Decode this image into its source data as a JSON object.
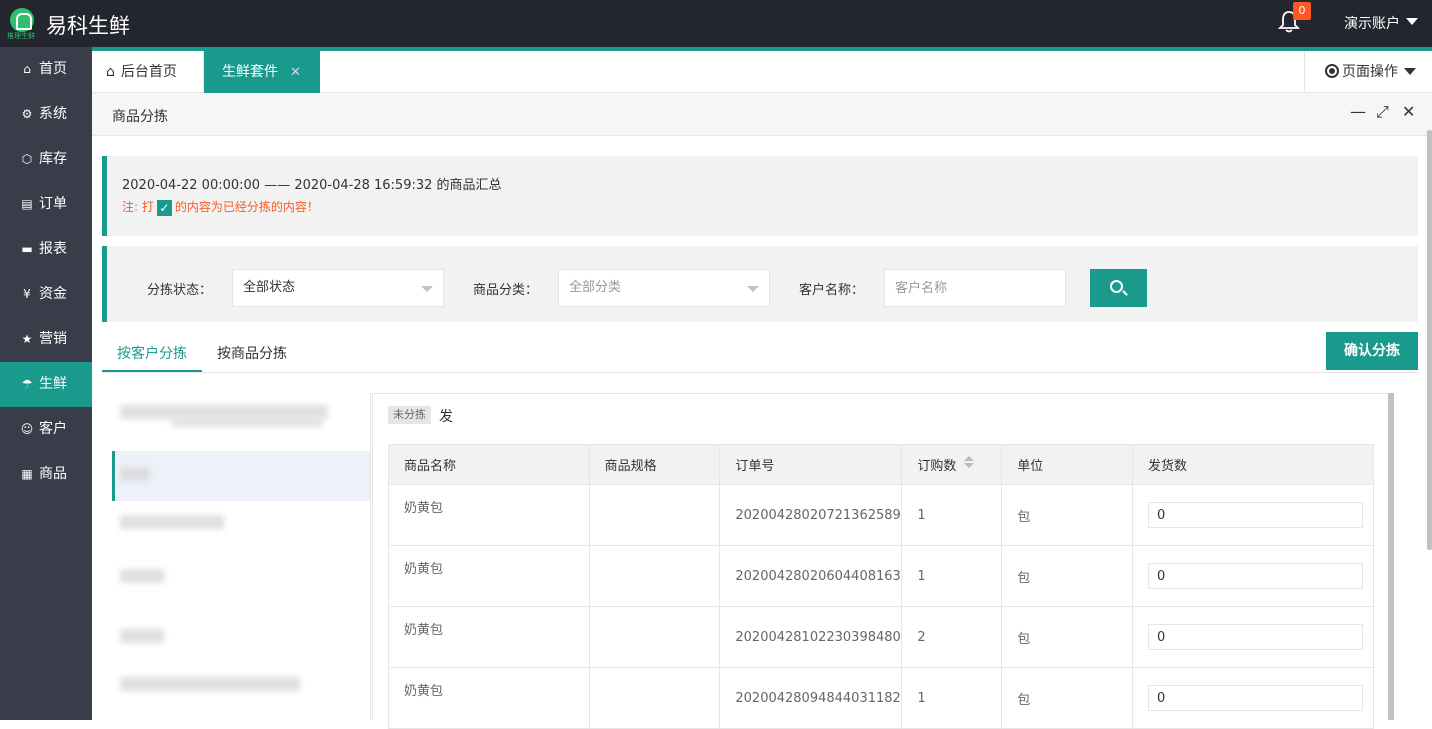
{
  "header": {
    "app_title": "易科生鲜",
    "logo_sub": "推理生鲜",
    "notification_count": "0",
    "account_label": "演示账户"
  },
  "sidebar": {
    "items": [
      {
        "label": "首页",
        "icon": "home-icon"
      },
      {
        "label": "系统",
        "icon": "gear-icon"
      },
      {
        "label": "库存",
        "icon": "box-icon"
      },
      {
        "label": "订单",
        "icon": "document-icon"
      },
      {
        "label": "报表",
        "icon": "monitor-icon"
      },
      {
        "label": "资金",
        "icon": "yen-icon"
      },
      {
        "label": "营销",
        "icon": "star-icon"
      },
      {
        "label": "生鲜",
        "icon": "umbrella-icon",
        "active": true
      },
      {
        "label": "客户",
        "icon": "user-icon"
      },
      {
        "label": "商品",
        "icon": "grid-icon"
      }
    ]
  },
  "tabs": {
    "home_label": "后台首页",
    "active_label": "生鲜套件",
    "page_ops_label": "页面操作"
  },
  "panel": {
    "title": "商品分拣"
  },
  "notice": {
    "summary": "2020-04-22 00:00:00 —— 2020-04-28 16:59:32 的商品汇总",
    "note_prefix": "注: 打",
    "note_suffix": "的内容为已经分拣的内容！"
  },
  "filters": {
    "status_label": "分拣状态：",
    "status_value": "全部状态",
    "category_label": "商品分类：",
    "category_value": "全部分类",
    "customer_label": "客户名称：",
    "customer_placeholder": "客户名称"
  },
  "sort_tabs": {
    "by_customer": "按客户分拣",
    "by_product": "按商品分拣",
    "confirm_label": "确认分拣"
  },
  "detail": {
    "status_tag": "未分拣",
    "status_text": "发",
    "columns": [
      "商品名称",
      "商品规格",
      "订单号",
      "订购数",
      "单位",
      "发货数"
    ],
    "rows": [
      {
        "name": "奶黄包",
        "spec": "",
        "order_no": "20200428020721362589",
        "qty": "1",
        "unit": "包",
        "ship": "0"
      },
      {
        "name": "奶黄包",
        "spec": "",
        "order_no": "20200428020604408163",
        "qty": "1",
        "unit": "包",
        "ship": "0"
      },
      {
        "name": "奶黄包",
        "spec": "",
        "order_no": "20200428102230398480",
        "qty": "2",
        "unit": "包",
        "ship": "0"
      },
      {
        "name": "奶黄包",
        "spec": "",
        "order_no": "20200428094844031182",
        "qty": "1",
        "unit": "包",
        "ship": "0"
      }
    ]
  },
  "colors": {
    "accent": "#1a9a8c",
    "topbar": "#23262e",
    "sidebar": "#393d49",
    "warning": "#ff5722"
  }
}
